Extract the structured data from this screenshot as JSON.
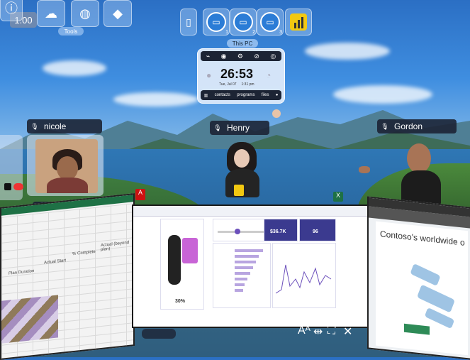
{
  "zoom_level": "1.00",
  "tools": {
    "label": "Tools",
    "icons": [
      "info-icon",
      "cloud-icon",
      "basketball-icon",
      "vr-logo-icon"
    ]
  },
  "monitors": {
    "label": "This PC",
    "items": [
      {
        "icon": "phone-icon",
        "number": ""
      },
      {
        "icon": "monitor-icon",
        "number": "1"
      },
      {
        "icon": "monitor-icon",
        "number": "2"
      },
      {
        "icon": "monitor-icon",
        "number": "3"
      },
      {
        "icon": "powerbi-icon",
        "number": ""
      }
    ]
  },
  "clock": {
    "time": "26:53",
    "date_left": "Tue, Jul 07",
    "date_right": "1:31 pm",
    "buttons": [
      "contacts",
      "programs",
      "files"
    ]
  },
  "participants": [
    {
      "name": "nicole"
    },
    {
      "name": "Henry"
    },
    {
      "name": "Gordon"
    }
  ],
  "screens": {
    "excel": {
      "labels": [
        "Plan Duration",
        "Actual Start",
        "% Complete",
        "Actual (beyond plan)"
      ]
    },
    "powerbi": {
      "value_1": "$36.7K",
      "value_2": "96",
      "percent": "30%"
    },
    "powerpoint": {
      "title": "Contoso's worldwide o"
    }
  },
  "colors": {
    "nametag_bg": "#1c2434",
    "excel_green": "#1e7145",
    "powerbi_accent": "#6b4fbb",
    "powerbi_header": "#3b3a8f"
  }
}
